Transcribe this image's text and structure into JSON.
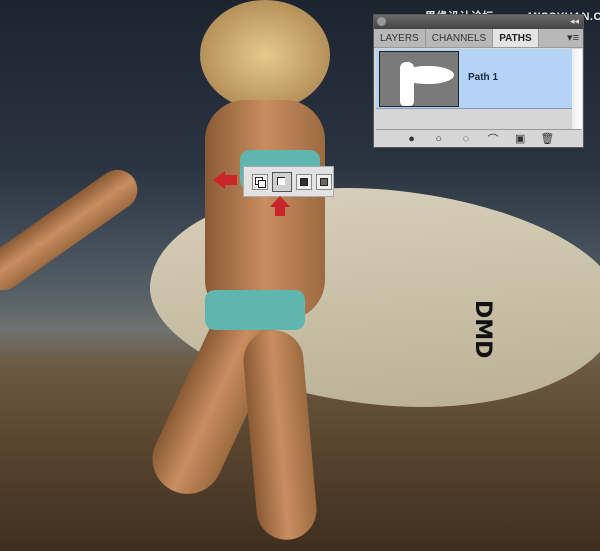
{
  "watermark": "思缘设计论坛 www.MISSYUAN.COM",
  "panel": {
    "tabs": [
      {
        "label": "LAYERS"
      },
      {
        "label": "CHANNELS"
      },
      {
        "label": "PATHS",
        "active": true
      }
    ],
    "menu_icon": "panel-menu-icon",
    "paths": [
      {
        "name": "Path 1",
        "selected": true
      }
    ],
    "bottom_icons": [
      "fill-path-icon",
      "stroke-path-icon",
      "load-as-selection-icon",
      "make-work-path-icon",
      "new-path-icon",
      "delete-path-icon"
    ]
  },
  "toolbar": {
    "modes": [
      "new-selection",
      "add-to-selection",
      "subtract-from-selection",
      "intersect-selection"
    ],
    "selected_mode": "add-to-selection"
  },
  "colors": {
    "selection_highlight": "#b4d3f7",
    "arrow": "#c8262a"
  }
}
